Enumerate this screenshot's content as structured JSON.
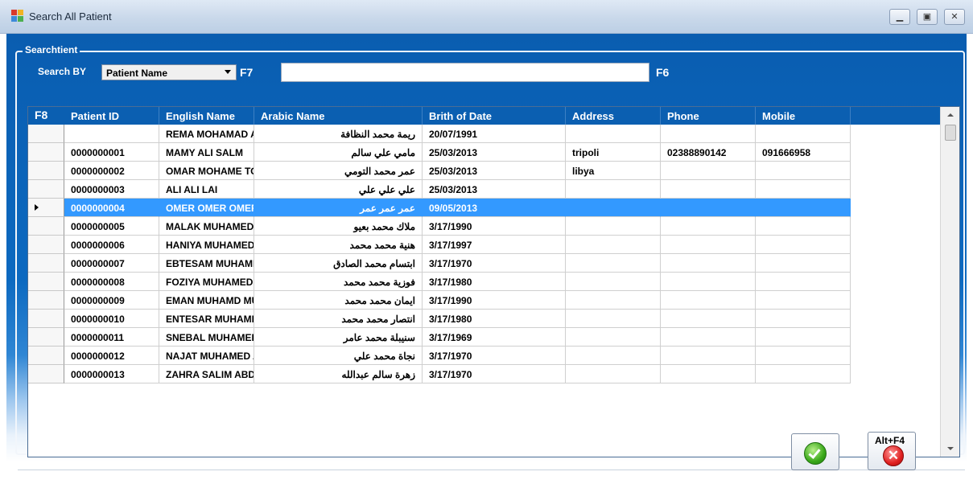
{
  "window": {
    "title": "Search All Patient",
    "controls": [
      "minimize",
      "restore",
      "close"
    ]
  },
  "search": {
    "group_title": "Searchtient",
    "by_label": "Search BY",
    "by_value": "Patient Name",
    "combo_hotkey": "F7",
    "text_value": "",
    "text_hotkey": "F6",
    "grid_hotkey": "F8"
  },
  "grid": {
    "columns": [
      "Patient ID",
      "English Name",
      "Arabic Name",
      "Brith of Date",
      "Address",
      "Phone",
      "Mobile"
    ],
    "selected_row": 4,
    "rows": [
      [
        "",
        "REMA MOHAMAD ALN...",
        "ريمة محمد النظافة",
        "20/07/1991",
        "",
        "",
        ""
      ],
      [
        "0000000001",
        "MAMY ALI SALM",
        "مامي علي سالم",
        "25/03/2013",
        "tripoli",
        "02388890142",
        "091666958"
      ],
      [
        "0000000002",
        "OMAR MOHAME TOMI",
        "عمر محمد التومي",
        "25/03/2013",
        "libya",
        "",
        ""
      ],
      [
        "0000000003",
        "ALI ALI LAI",
        "علي علي علي",
        "25/03/2013",
        "",
        "",
        ""
      ],
      [
        "0000000004",
        "OMER OMER OMER",
        "عمر عمر عمر",
        "09/05/2013",
        "",
        "",
        ""
      ],
      [
        "0000000005",
        "MALAK MUHAMED BAIYO",
        "ملاك محمد بعيو",
        "3/17/1990",
        "",
        "",
        ""
      ],
      [
        "0000000006",
        "HANIYA MUHAMED MU...",
        "هنية محمد محمد",
        "3/17/1997",
        "",
        "",
        ""
      ],
      [
        "0000000007",
        "EBTESAM MUHAMED A...",
        "ابتسام محمد الصادق",
        "3/17/1970",
        "",
        "",
        ""
      ],
      [
        "0000000008",
        "FOZIYA MUHAMED MU...",
        "فوزية محمد محمد",
        "3/17/1980",
        "",
        "",
        ""
      ],
      [
        "0000000009",
        "EMAN MUHAMD MUHA...",
        "ايمان محمد محمد",
        "3/17/1990",
        "",
        "",
        ""
      ],
      [
        "0000000010",
        "ENTESAR MUHAMED ...",
        "انتصار محمد محمد",
        "3/17/1980",
        "",
        "",
        ""
      ],
      [
        "0000000011",
        "SNEBAL MUHAMED AM...",
        "سنيبلة محمد عامر",
        "3/17/1969",
        "",
        "",
        ""
      ],
      [
        "0000000012",
        "NAJAT MUHAMED ALI",
        "نجاة محمد علي",
        "3/17/1970",
        "",
        "",
        ""
      ],
      [
        "0000000013",
        "ZAHRA SALIM ABDALL...",
        "زهرة سالم عبدالله",
        "3/17/1970",
        "",
        "",
        ""
      ]
    ]
  },
  "buttons": {
    "ok_icon": "green-check-icon",
    "cancel_label": "Alt+F4",
    "cancel_icon": "red-x-icon"
  },
  "colors": {
    "form_blue": "#0a5db0",
    "header_blue": "#0b5fb1",
    "selection": "#3399ff"
  }
}
